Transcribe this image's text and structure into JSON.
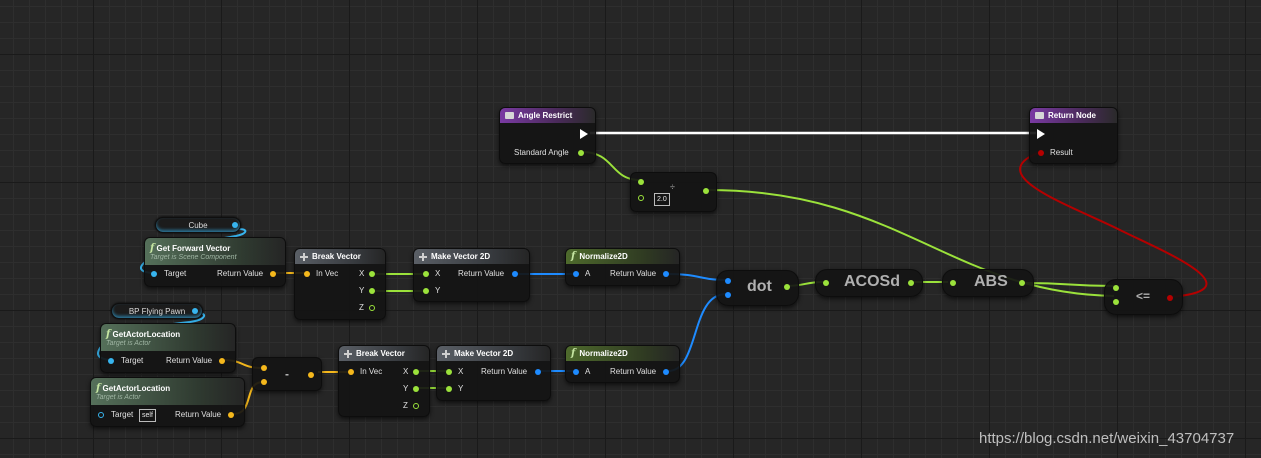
{
  "graph": {
    "nodes": {
      "angle_restrict": {
        "title": "Angle Restrict",
        "pin": "Standard Angle"
      },
      "return_node": {
        "title": "Return Node",
        "pin": "Result"
      },
      "divide": {
        "op": "÷",
        "literal": "2.0"
      },
      "cube": {
        "title": "Cube"
      },
      "get_forward_vector": {
        "title": "Get Forward Vector",
        "subtitle": "Target is Scene Component",
        "pin_target": "Target",
        "pin_return": "Return Value"
      },
      "break_vector_1": {
        "title": "Break Vector",
        "pin_in": "In Vec",
        "pin_x": "X",
        "pin_y": "Y",
        "pin_z": "Z"
      },
      "make_vector2d_1": {
        "title": "Make Vector 2D",
        "pin_x": "X",
        "pin_y": "Y",
        "pin_return": "Return Value"
      },
      "normalize2d_1": {
        "title": "Normalize2D",
        "pin_a": "A",
        "pin_return": "Return Value"
      },
      "dot": {
        "label": "dot"
      },
      "acosd": {
        "label": "ACOSd"
      },
      "abs": {
        "label": "ABS"
      },
      "leq": {
        "label": "<="
      },
      "bp_flying_pawn": {
        "title": "BP Flying Pawn"
      },
      "get_actor_location_1": {
        "title": "GetActorLocation",
        "subtitle": "Target is Actor",
        "pin_target": "Target",
        "pin_return": "Return Value"
      },
      "get_actor_location_2": {
        "title": "GetActorLocation",
        "subtitle": "Target is Actor",
        "pin_target": "Target",
        "self_literal": "self",
        "pin_return": "Return Value"
      },
      "subtract": {
        "label": "-"
      },
      "break_vector_2": {
        "title": "Break Vector",
        "pin_in": "In Vec",
        "pin_x": "X",
        "pin_y": "Y",
        "pin_z": "Z"
      },
      "make_vector2d_2": {
        "title": "Make Vector 2D",
        "pin_x": "X",
        "pin_y": "Y",
        "pin_return": "Return Value"
      },
      "normalize2d_2": {
        "title": "Normalize2D",
        "pin_a": "A",
        "pin_return": "Return Value"
      }
    },
    "colors": {
      "float": "#9be23b",
      "vector": "#f5b81c",
      "vector2d": "#1e8bff",
      "object": "#37b4ee",
      "bool": "#b50000",
      "exec": "#ffffff",
      "function_header": "#7a3aa3"
    }
  },
  "watermark": "https://blog.csdn.net/weixin_43704737"
}
